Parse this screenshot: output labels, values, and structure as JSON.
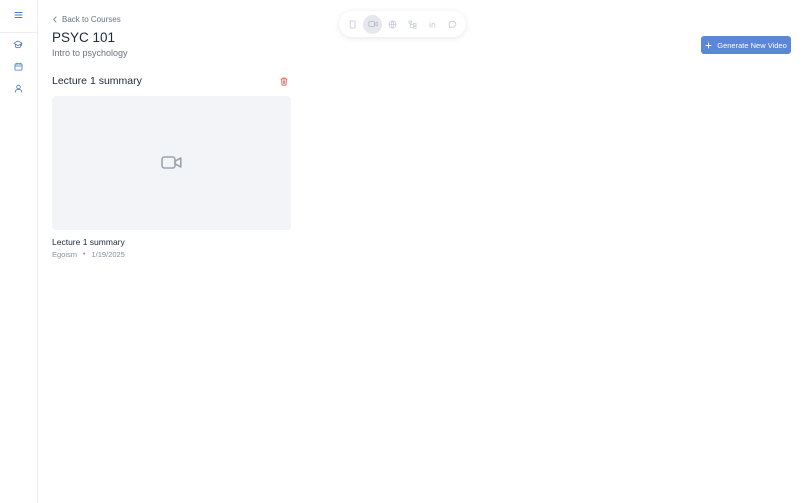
{
  "nav": {
    "back_label": "Back to Courses"
  },
  "course": {
    "code": "PSYC 101",
    "name": "Intro to psychology"
  },
  "actions": {
    "generate_label": "Generate New Video"
  },
  "section": {
    "title": "Lecture 1 summary"
  },
  "video": {
    "title": "Lecture 1 summary",
    "author": "Egoism",
    "separator": "•",
    "date": "1/19/2025"
  },
  "toolbar": {
    "items": [
      "book-icon",
      "video-icon",
      "globe-icon",
      "network-icon",
      "linkedin-icon",
      "chat-icon"
    ],
    "active": "video-icon"
  },
  "colors": {
    "accent": "#5b87d6",
    "danger": "#e25555",
    "sidebar_icon": "#4b77c9"
  }
}
